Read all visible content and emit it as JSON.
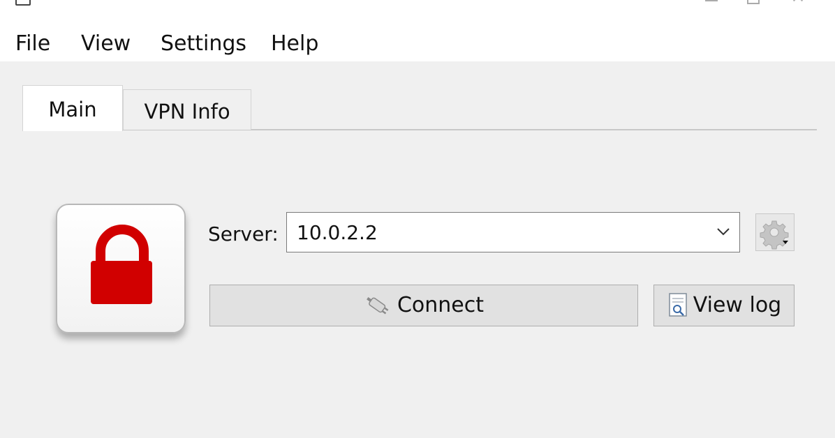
{
  "menu": {
    "items": [
      "File",
      "View",
      "Settings",
      "Help"
    ]
  },
  "tabs": [
    {
      "label": "Main",
      "active": true
    },
    {
      "label": "VPN Info",
      "active": false
    }
  ],
  "status": {
    "lock_icon": "lock-icon",
    "lock_color": "#d10000"
  },
  "server": {
    "label": "Server:",
    "value": "10.0.2.2"
  },
  "buttons": {
    "connect_label": "Connect",
    "connect_icon": "plug-icon",
    "view_log_label": "View log",
    "view_log_icon": "log-document-icon",
    "settings_icon": "gear-icon"
  }
}
